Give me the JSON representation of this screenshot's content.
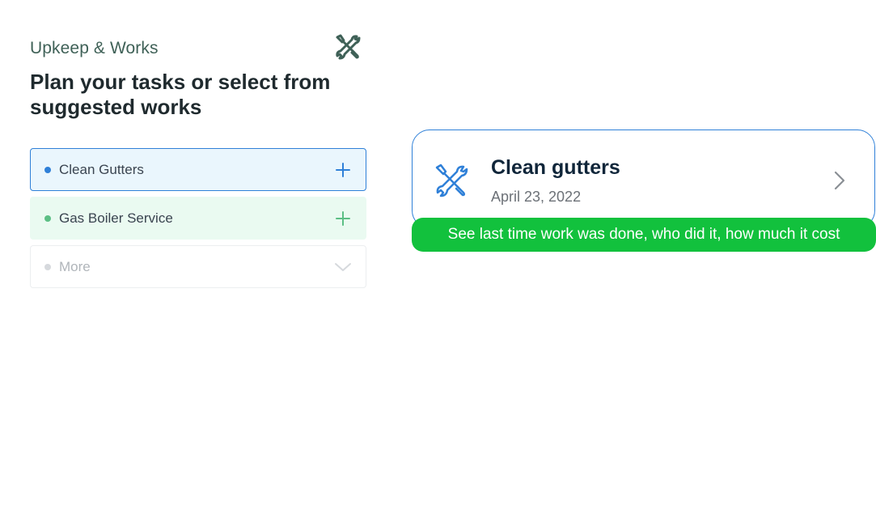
{
  "header": {
    "section_label": "Upkeep & Works",
    "title": "Plan your tasks or select from suggested works",
    "icon": "tools-icon"
  },
  "tasks": [
    {
      "label": "Clean Gutters",
      "action_icon": "plus-icon",
      "color": "#2f80d8",
      "text_color": "#3a4450"
    },
    {
      "label": "Gas Boiler Service",
      "action_icon": "plus-icon",
      "color": "#5cbf85",
      "text_color": "#3a4450"
    },
    {
      "label": "More",
      "action_icon": "chevron-down-icon",
      "color": "#d6d9dd",
      "text_color": "#b0b5ba"
    }
  ],
  "card": {
    "title": "Clean gutters",
    "date": "April 23, 2022",
    "icon": "tools-icon",
    "chevron_icon": "chevron-right-icon"
  },
  "tooltip": {
    "text": "See last time work was done, who did it, how much it cost",
    "color": "#12c13d"
  },
  "colors": {
    "accent_blue": "#2f80d8",
    "accent_green": "#12c13d",
    "header_green": "#3f6157"
  }
}
